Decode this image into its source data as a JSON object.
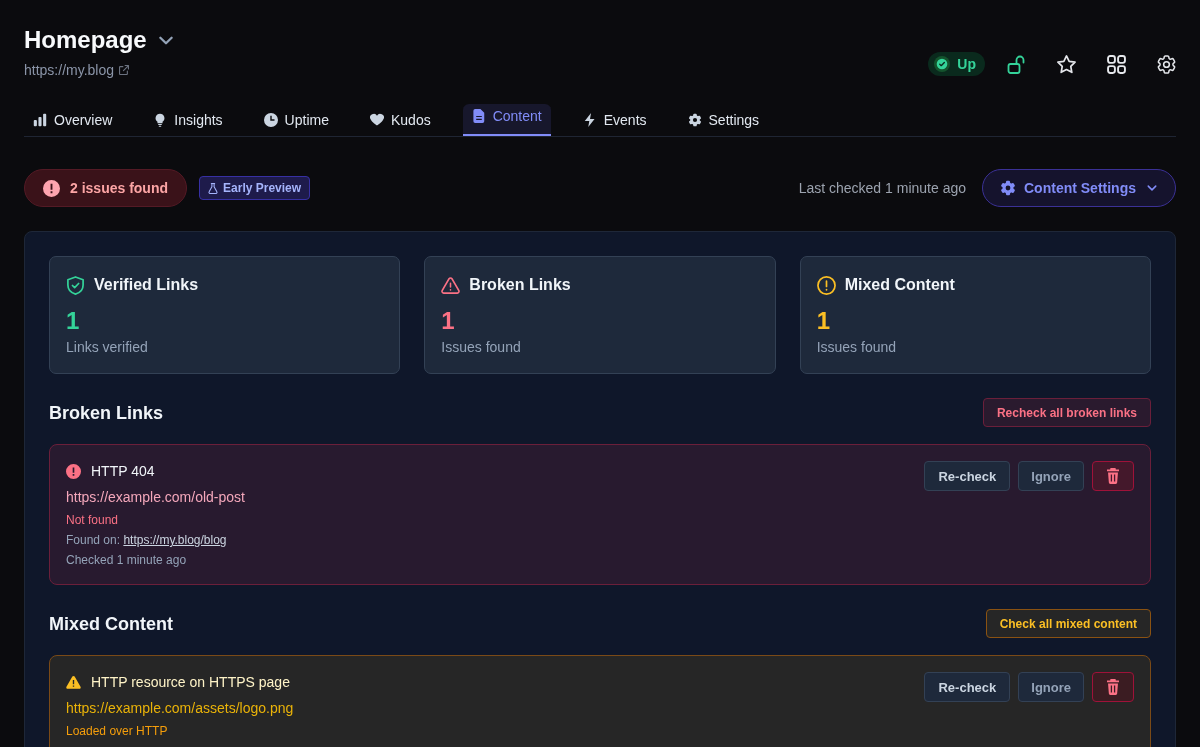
{
  "header": {
    "title": "Homepage",
    "url": "https://my.blog",
    "status": {
      "label": "Up",
      "kind": "up"
    }
  },
  "tabs": [
    {
      "label": "Overview",
      "selected": false
    },
    {
      "label": "Insights",
      "selected": false
    },
    {
      "label": "Uptime",
      "selected": false
    },
    {
      "label": "Kudos",
      "selected": false
    },
    {
      "label": "Content",
      "selected": true
    },
    {
      "label": "Events",
      "selected": false
    },
    {
      "label": "Settings",
      "selected": false
    }
  ],
  "summary": {
    "issues": "2 issues found",
    "badge": "Early Preview",
    "last_checked": "Last checked 1 minute ago",
    "settings_button": "Content Settings"
  },
  "stats": [
    {
      "kind": "verified",
      "title": "Verified Links",
      "value": "1",
      "caption": "Links verified"
    },
    {
      "kind": "broken",
      "title": "Broken Links",
      "value": "1",
      "caption": "Issues found"
    },
    {
      "kind": "mixed",
      "title": "Mixed Content",
      "value": "1",
      "caption": "Issues found"
    }
  ],
  "sections": [
    {
      "kind": "broken",
      "heading": "Broken Links",
      "action": "Recheck all broken links",
      "items": [
        {
          "title": "HTTP 404",
          "url": "https://example.com/old-post",
          "reason": "Not found",
          "found_on": {
            "label": "Found on:",
            "url": "https://my.blog/blog"
          },
          "checked": "Checked 1 minute ago",
          "actions": [
            {
              "kind": "recheck",
              "label": "Re-check"
            },
            {
              "kind": "ignore",
              "label": "Ignore"
            }
          ]
        }
      ]
    },
    {
      "kind": "mixed",
      "heading": "Mixed Content",
      "action": "Check all mixed content",
      "items": [
        {
          "title": "HTTP resource on HTTPS page",
          "url": "https://example.com/assets/logo.png",
          "reason": "Loaded over HTTP",
          "actions": [
            {
              "kind": "recheck",
              "label": "Re-check"
            },
            {
              "kind": "ignore",
              "label": "Ignore"
            }
          ]
        }
      ]
    }
  ]
}
